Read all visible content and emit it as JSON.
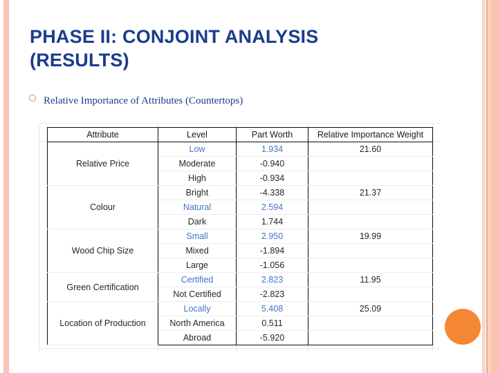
{
  "slide": {
    "title": "PHASE II: CONJOINT ANALYSIS (RESULTS)",
    "bullet": "Relative Importance of Attributes (Countertops)",
    "bullet_icon": "hollow-circle-bullet-icon",
    "title_color": "#1B3C8E",
    "accent_color": "#F58634",
    "highlight_color": "#4472C4"
  },
  "table": {
    "headers": [
      "Attribute",
      "Level",
      "Part Worth",
      "Relative Importance Weight"
    ],
    "groups": [
      {
        "attribute": "Relative Price",
        "weight": "21.60",
        "rows": [
          {
            "level": "Low",
            "part_worth": "1.934",
            "best": true
          },
          {
            "level": "Moderate",
            "part_worth": "-0.940",
            "best": false
          },
          {
            "level": "High",
            "part_worth": "-0.934",
            "best": false
          }
        ]
      },
      {
        "attribute": "Colour",
        "weight": "21.37",
        "rows": [
          {
            "level": "Bright",
            "part_worth": "-4.338",
            "best": false
          },
          {
            "level": "Natural",
            "part_worth": "2.594",
            "best": true
          },
          {
            "level": "Dark",
            "part_worth": "1.744",
            "best": false
          }
        ]
      },
      {
        "attribute": "Wood Chip Size",
        "weight": "19.99",
        "rows": [
          {
            "level": "Small",
            "part_worth": "2.950",
            "best": true
          },
          {
            "level": "Mixed",
            "part_worth": "-1.894",
            "best": false
          },
          {
            "level": "Large",
            "part_worth": "-1.056",
            "best": false
          }
        ]
      },
      {
        "attribute": "Green Certification",
        "weight": "11.95",
        "rows": [
          {
            "level": "Certified",
            "part_worth": "2.823",
            "best": true
          },
          {
            "level": "Not Certified",
            "part_worth": "-2.823",
            "best": false
          }
        ]
      },
      {
        "attribute": "Location of Production",
        "weight": "25.09",
        "rows": [
          {
            "level": "Locally",
            "part_worth": "5.408",
            "best": true
          },
          {
            "level": "North America",
            "part_worth": "0.511",
            "best": false
          },
          {
            "level": "Abroad",
            "part_worth": "-5.920",
            "best": false
          }
        ]
      }
    ]
  },
  "chart_data": {
    "type": "table",
    "title": "Relative Importance of Attributes (Countertops)",
    "columns": [
      "Attribute",
      "Level",
      "Part Worth",
      "Relative Importance Weight"
    ],
    "rows": [
      [
        "Relative Price",
        "Low",
        1.934,
        21.6
      ],
      [
        "Relative Price",
        "Moderate",
        -0.94,
        null
      ],
      [
        "Relative Price",
        "High",
        -0.934,
        null
      ],
      [
        "Colour",
        "Bright",
        -4.338,
        21.37
      ],
      [
        "Colour",
        "Natural",
        2.594,
        null
      ],
      [
        "Colour",
        "Dark",
        1.744,
        null
      ],
      [
        "Wood Chip Size",
        "Small",
        2.95,
        19.99
      ],
      [
        "Wood Chip Size",
        "Mixed",
        -1.894,
        null
      ],
      [
        "Wood Chip Size",
        "Large",
        -1.056,
        null
      ],
      [
        "Green Certification",
        "Certified",
        2.823,
        11.95
      ],
      [
        "Green Certification",
        "Not Certified",
        -2.823,
        null
      ],
      [
        "Location of Production",
        "Locally",
        5.408,
        25.09
      ],
      [
        "Location of Production",
        "North America",
        0.511,
        null
      ],
      [
        "Location of Production",
        "Abroad",
        -5.92,
        null
      ]
    ],
    "importance_weights": {
      "categories": [
        "Relative Price",
        "Colour",
        "Wood Chip Size",
        "Green Certification",
        "Location of Production"
      ],
      "values": [
        21.6,
        21.37,
        19.99,
        11.95,
        25.09
      ]
    },
    "highlighted_levels": [
      "Low",
      "Natural",
      "Small",
      "Certified",
      "Locally"
    ]
  }
}
